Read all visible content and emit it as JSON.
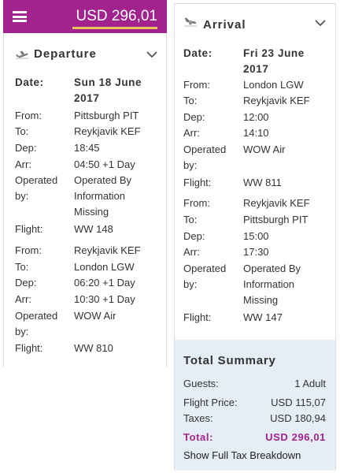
{
  "header": {
    "price": "USD 296,01",
    "colors": {
      "brand": "#a3238e",
      "underline": "#e8c45a"
    }
  },
  "departure": {
    "title": "Departure",
    "date_label": "Date:",
    "date_value": "Sun 18 June\n2017",
    "segments": [
      {
        "from_label": "From:",
        "from": "Pittsburgh PIT",
        "to_label": "To:",
        "to": "Reykjavik KEF",
        "dep_label": "Dep:",
        "dep": "18:45",
        "arr_label": "Arr:",
        "arr": "04:50 +1 Day",
        "op_label": "Operated\nby:",
        "operator": "Operated By\nInformation\nMissing",
        "flight_label": "Flight:",
        "flight": "WW 148"
      },
      {
        "from_label": "From:",
        "from": "Reykjavik KEF",
        "to_label": "To:",
        "to": "London LGW",
        "dep_label": "Dep:",
        "dep": "06:20 +1 Day",
        "arr_label": "Arr:",
        "arr": "10:30 +1 Day",
        "op_label": "Operated\nby:",
        "operator": "WOW Air",
        "flight_label": "Flight:",
        "flight": "WW 810"
      }
    ]
  },
  "arrival": {
    "title": "Arrival",
    "date_label": "Date:",
    "date_value": "Fri 23 June\n2017",
    "segments": [
      {
        "from_label": "From:",
        "from": "London LGW",
        "to_label": "To:",
        "to": "Reykjavik KEF",
        "dep_label": "Dep:",
        "dep": "12:00",
        "arr_label": "Arr:",
        "arr": "14:10",
        "op_label": "Operated\nby:",
        "operator": "WOW Air",
        "flight_label": "Flight:",
        "flight": "WW 811"
      },
      {
        "from_label": "From:",
        "from": "Reykjavik KEF",
        "to_label": "To:",
        "to": "Pittsburgh PIT",
        "dep_label": "Dep:",
        "dep": "15:00",
        "arr_label": "Arr:",
        "arr": "17:30",
        "op_label": "Operated\nby:",
        "operator": "Operated By\nInformation\nMissing",
        "flight_label": "Flight:",
        "flight": "WW 147"
      }
    ]
  },
  "summary": {
    "title": "Total Summary",
    "guests_label": "Guests:",
    "guests": "1 Adult",
    "flight_price_label": "Flight Price:",
    "flight_price": "USD 115,07",
    "taxes_label": "Taxes:",
    "taxes": "USD 180,94",
    "total_label": "Total:",
    "total": "USD 296,01",
    "tax_link": "Show Full Tax Breakdown",
    "colors": {
      "background": "#e5edf6",
      "total": "#a3238e"
    }
  },
  "icons": [
    "menu-icon",
    "plane-takeoff-icon",
    "plane-landing-icon",
    "chevron-down-icon"
  ]
}
